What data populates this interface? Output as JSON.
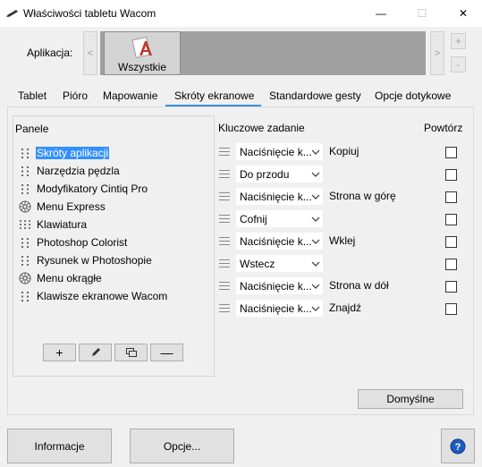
{
  "window": {
    "title": "Właściwości tabletu Wacom",
    "minimize_glyph": "—",
    "maximize_glyph": "☐",
    "close_glyph": "✕"
  },
  "application_bar": {
    "label": "Aplikacja:",
    "scroll_left_glyph": "<",
    "scroll_right_glyph": ">",
    "apps": [
      {
        "label": "Wszystkie",
        "icon": "all-apps-icon",
        "selected": true
      }
    ],
    "add_glyph": "+",
    "remove_glyph": "-"
  },
  "tabs": [
    {
      "label": "Tablet",
      "active": false
    },
    {
      "label": "Pióro",
      "active": false
    },
    {
      "label": "Mapowanie",
      "active": false
    },
    {
      "label": "Skróty ekranowe",
      "active": true
    },
    {
      "label": "Standardowe gesty",
      "active": false
    },
    {
      "label": "Opcje dotykowe",
      "active": false
    }
  ],
  "panels": {
    "header": "Panele",
    "items": [
      {
        "label": "Skróty aplikacji",
        "icon": "grid-panel-icon",
        "selected": true
      },
      {
        "label": "Narzędzia pędzla",
        "icon": "grid-panel-icon",
        "selected": false
      },
      {
        "label": "Modyfikatory Cintiq Pro",
        "icon": "grid-panel-icon",
        "selected": false
      },
      {
        "label": "Menu Express",
        "icon": "radial-menu-icon",
        "selected": false
      },
      {
        "label": "Klawiatura",
        "icon": "keyboard-grid-icon",
        "selected": false
      },
      {
        "label": "Photoshop Colorist",
        "icon": "grid-panel-icon",
        "selected": false
      },
      {
        "label": "Rysunek w Photoshopie",
        "icon": "grid-panel-icon",
        "selected": false
      },
      {
        "label": "Menu okrągłe",
        "icon": "radial-menu-icon",
        "selected": false
      },
      {
        "label": "Klawisze ekranowe Wacom",
        "icon": "grid-panel-icon",
        "selected": false
      }
    ],
    "toolbar": {
      "add_glyph": "+",
      "edit_icon": "pencil-icon",
      "duplicate_icon": "duplicate-icon",
      "remove_glyph": "—"
    }
  },
  "assignments": {
    "header_task": "Kluczowe zadanie",
    "header_repeat": "Powtórz",
    "rows": [
      {
        "action": "Naciśnięcie k...",
        "label": "Kopiuj",
        "repeat": false
      },
      {
        "action": "Do przodu",
        "label": "",
        "repeat": false
      },
      {
        "action": "Naciśnięcie k...",
        "label": "Strona w górę",
        "repeat": false
      },
      {
        "action": "Cofnij",
        "label": "",
        "repeat": false
      },
      {
        "action": "Naciśnięcie k...",
        "label": "Wklej",
        "repeat": false
      },
      {
        "action": "Wstecz",
        "label": "",
        "repeat": false
      },
      {
        "action": "Naciśnięcie k...",
        "label": "Strona w dół",
        "repeat": false
      },
      {
        "action": "Naciśnięcie k...",
        "label": "Znajdź",
        "repeat": false
      }
    ]
  },
  "default_button": "Domyślne",
  "footer": {
    "info_button": "Informacje",
    "options_button": "Opcje...",
    "help_glyph": "?"
  },
  "colors": {
    "accent": "#3b8fd9",
    "selection": "#3390ff",
    "help_blue": "#1e5bbf"
  }
}
